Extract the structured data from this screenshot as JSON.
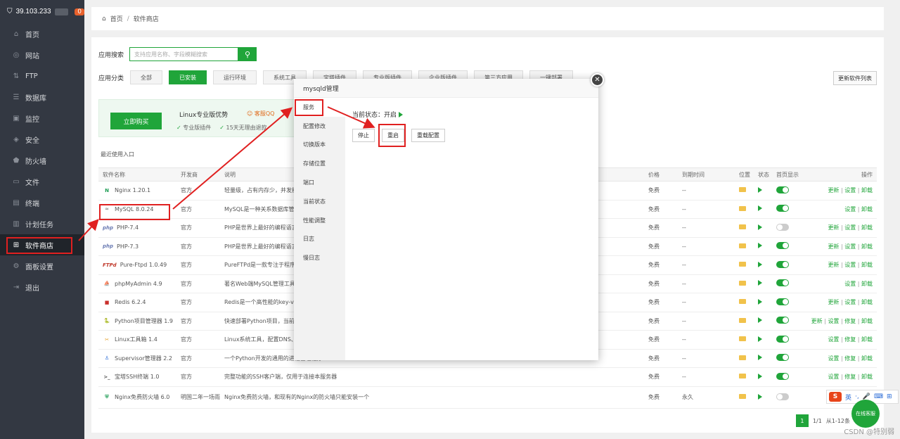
{
  "sidebar": {
    "ip": "39.103.233",
    "badge": "0",
    "items": [
      {
        "label": "首页",
        "icon": "home-icon",
        "glyph": "⌂"
      },
      {
        "label": "网站",
        "icon": "globe-icon",
        "glyph": "◎"
      },
      {
        "label": "FTP",
        "icon": "ftp-icon",
        "glyph": "⇅"
      },
      {
        "label": "数据库",
        "icon": "database-icon",
        "glyph": "☰"
      },
      {
        "label": "监控",
        "icon": "monitor-icon",
        "glyph": "▣"
      },
      {
        "label": "安全",
        "icon": "shield-icon",
        "glyph": "◈"
      },
      {
        "label": "防火墙",
        "icon": "firewall-icon",
        "glyph": "⬟"
      },
      {
        "label": "文件",
        "icon": "folder-icon",
        "glyph": "▭"
      },
      {
        "label": "终端",
        "icon": "terminal-icon",
        "glyph": "▤"
      },
      {
        "label": "计划任务",
        "icon": "task-icon",
        "glyph": "▥"
      },
      {
        "label": "软件商店",
        "icon": "grid-icon",
        "glyph": "⊞"
      },
      {
        "label": "面板设置",
        "icon": "gear-icon",
        "glyph": "⚙"
      },
      {
        "label": "退出",
        "icon": "logout-icon",
        "glyph": "⇥"
      }
    ],
    "active_index": 10
  },
  "breadcrumb": {
    "home": "首页",
    "sep": "/",
    "current": "软件商店"
  },
  "search": {
    "label": "应用搜索",
    "placeholder": "支持应用名称、字段模糊搜索"
  },
  "categories": {
    "label": "应用分类",
    "items": [
      "全部",
      "已安装",
      "运行环境",
      "系统工具",
      "宝塔插件",
      "专业版插件",
      "企业版插件",
      "第三方应用",
      "一键部署"
    ],
    "active_index": 1
  },
  "update_list_btn": "更新软件列表",
  "promo": {
    "buy": "立即购买",
    "title": "Linux专业版优势",
    "qq": "客服QQ",
    "features": [
      "专业版插件",
      "15天无理由退款"
    ]
  },
  "recent_label": "最近使用入口",
  "table": {
    "headers": {
      "name": "软件名称",
      "dev": "开发商",
      "desc": "说明",
      "price": "价格",
      "exp": "到期时间",
      "loc": "位置",
      "stat": "状态",
      "home": "首页显示",
      "op": "操作"
    },
    "rows": [
      {
        "name": "Nginx 1.20.1",
        "icon": "nginx-icon",
        "glyph": "N",
        "color": "#1f9d55",
        "dev": "官方",
        "desc": "轻量级，占有内存少，并发能力强",
        "price": "免费",
        "exp": "--",
        "on": true,
        "ops": [
          "更新",
          "设置",
          "卸载"
        ]
      },
      {
        "name": "MySQL 8.0.24",
        "icon": "mysql-icon",
        "glyph": "≈",
        "color": "#888",
        "dev": "官方",
        "desc": "MySQL是一种关系数据库管理系统!",
        "price": "免费",
        "exp": "--",
        "on": true,
        "ops": [
          "设置",
          "卸载"
        ]
      },
      {
        "name": "PHP-7.4",
        "icon": "php-icon",
        "glyph": "php",
        "color": "#6a7bb3",
        "dev": "官方",
        "desc": "PHP是世界上最好的编程语言",
        "price": "免费",
        "exp": "--",
        "on": false,
        "ops": [
          "更新",
          "设置",
          "卸载"
        ]
      },
      {
        "name": "PHP-7.3",
        "icon": "php-icon",
        "glyph": "php",
        "color": "#6a7bb3",
        "dev": "官方",
        "desc": "PHP是世界上最好的编程语言",
        "price": "免费",
        "exp": "--",
        "on": true,
        "ops": [
          "更新",
          "设置",
          "卸载"
        ]
      },
      {
        "name": "Pure-Ftpd 1.0.49",
        "icon": "ftpd-icon",
        "glyph": "FTPd",
        "color": "#c0392b",
        "dev": "官方",
        "desc": "PureFTPd是一款专注于程序健壮和软件安全的免费FTP服务器软件",
        "price": "免费",
        "exp": "--",
        "on": true,
        "ops": [
          "更新",
          "设置",
          "卸载"
        ]
      },
      {
        "name": "phpMyAdmin 4.9",
        "icon": "phpmyadmin-icon",
        "glyph": "⛵",
        "color": "#e39a1c",
        "dev": "官方",
        "desc": "著名Web端MySQL管理工具",
        "price": "免费",
        "exp": "--",
        "on": true,
        "ops": [
          "设置",
          "卸载"
        ]
      },
      {
        "name": "Redis 6.2.4",
        "icon": "redis-icon",
        "glyph": "■",
        "color": "#c9302c",
        "dev": "官方",
        "desc": "Redis是一个高性能的key-value数据库",
        "price": "免费",
        "exp": "--",
        "on": true,
        "ops": [
          "更新",
          "设置",
          "卸载"
        ]
      },
      {
        "name": "Python项目管理器 1.9",
        "icon": "python-icon",
        "glyph": "🐍",
        "color": "#3b77a8",
        "dev": "官方",
        "desc": "快速部署Python项目，当前仅支持Centos7以上版本",
        "price": "免费",
        "exp": "--",
        "on": true,
        "ops": [
          "更新",
          "设置",
          "修复",
          "卸载"
        ]
      },
      {
        "name": "Linux工具箱 1.4",
        "icon": "toolbox-icon",
        "glyph": "✂",
        "color": "#e39a1c",
        "dev": "官方",
        "desc": "Linux系统工具，配置DNS、Swap、时区、用户管理等",
        "price": "免费",
        "exp": "--",
        "on": true,
        "ops": [
          "设置",
          "修复",
          "卸载"
        ]
      },
      {
        "name": "Supervisor管理器 2.2",
        "icon": "supervisor-icon",
        "glyph": "♙",
        "color": "#2a6bd6",
        "dev": "官方",
        "desc": "一个Python开发的通用的进程管理程序",
        "price": "免费",
        "exp": "--",
        "on": true,
        "ops": [
          "设置",
          "修复",
          "卸载"
        ]
      },
      {
        "name": "宝塔SSH终端 1.0",
        "icon": "ssh-icon",
        "glyph": ">_",
        "color": "#555",
        "dev": "官方",
        "desc": "完整功能的SSH客户端，仅用于连接本服务器",
        "price": "免费",
        "exp": "--",
        "on": true,
        "ops": [
          "设置",
          "修复",
          "卸载"
        ]
      },
      {
        "name": "Nginx免费防火墙 6.0",
        "icon": "waf-icon",
        "glyph": "⛨",
        "color": "#1f9d55",
        "dev": "明国二年一场雨",
        "desc": "Nginx免费防火墙，和现有的Nginx的防火墙只能安装一个",
        "price": "免费",
        "exp": "永久",
        "on": false,
        "ops": [
          "更新",
          "设置"
        ]
      }
    ]
  },
  "pager": {
    "page": "1",
    "total": "1/1",
    "range": "从1-12条"
  },
  "watermark": "CSDN @特别弱",
  "kefu": "在线客服",
  "ime": {
    "lang": "英",
    "extra": "·,"
  },
  "modal": {
    "title": "mysqld管理",
    "menu": [
      "服务",
      "配置修改",
      "切换版本",
      "存储位置",
      "端口",
      "当前状态",
      "性能调整",
      "日志",
      "慢日志"
    ],
    "active_index": 0,
    "state_label": "当前状态：开启",
    "buttons": [
      "停止",
      "重启",
      "重载配置"
    ],
    "close": "✕"
  },
  "colors": {
    "accent": "#20a53a",
    "sidebar": "#333842",
    "annotation": "#e02020"
  }
}
